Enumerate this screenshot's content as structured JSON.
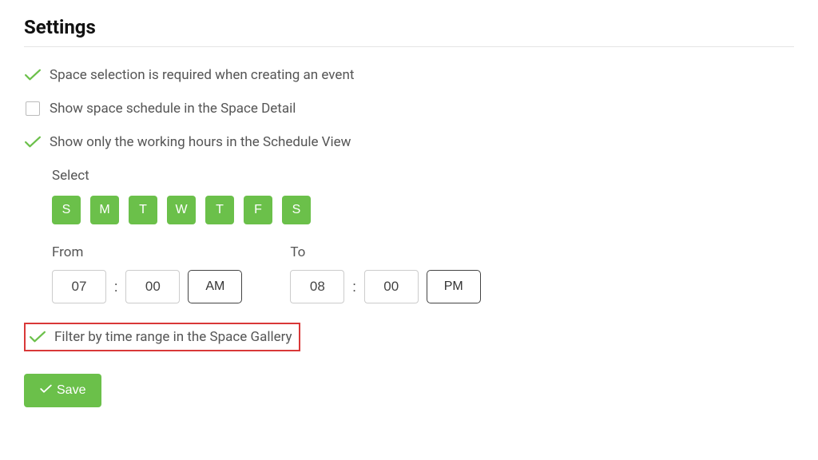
{
  "title": "Settings",
  "options": {
    "space_selection_required": "Space selection is required when creating an event",
    "show_space_schedule": "Show space schedule in the Space Detail",
    "show_working_hours": "Show only the working hours in the Schedule View",
    "filter_time_range": "Filter by time range in the Space Gallery"
  },
  "schedule": {
    "select_label": "Select",
    "days": [
      "S",
      "M",
      "T",
      "W",
      "T",
      "F",
      "S"
    ],
    "from_label": "From",
    "to_label": "To",
    "from_hour": "07",
    "from_min": "00",
    "from_ampm": "AM",
    "to_hour": "08",
    "to_min": "00",
    "to_ampm": "PM"
  },
  "save_label": "Save"
}
